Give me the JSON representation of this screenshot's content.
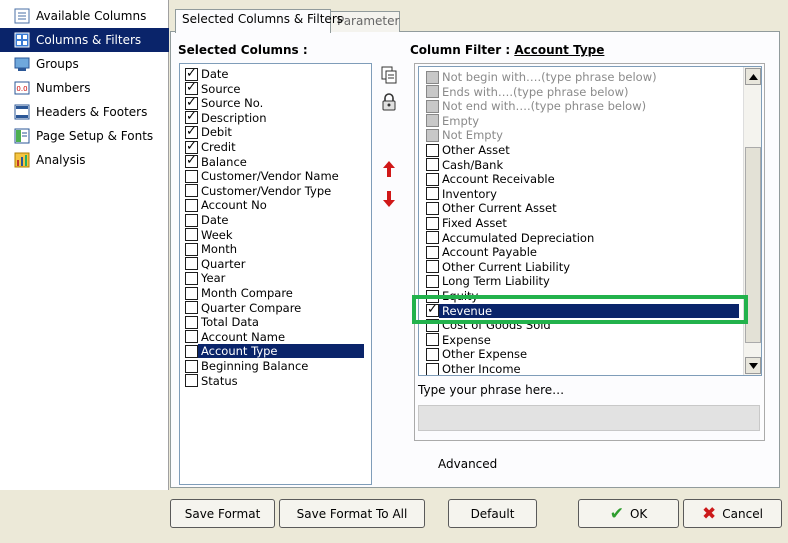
{
  "sidebar": {
    "items": [
      {
        "label": "Available Columns",
        "icon": "columns-list-icon",
        "selected": false
      },
      {
        "label": "Columns & Filters",
        "icon": "filter-grid-icon",
        "selected": true
      },
      {
        "label": "Groups",
        "icon": "groups-icon",
        "selected": false
      },
      {
        "label": "Numbers",
        "icon": "numbers-icon",
        "selected": false
      },
      {
        "label": "Headers & Footers",
        "icon": "header-footer-icon",
        "selected": false
      },
      {
        "label": "Page Setup & Fonts",
        "icon": "page-setup-icon",
        "selected": false
      },
      {
        "label": "Analysis",
        "icon": "chart-icon",
        "selected": false
      }
    ]
  },
  "tabs": [
    {
      "label": "Selected Columns & Filters",
      "active": true
    },
    {
      "label": "Parameter",
      "active": false
    }
  ],
  "selected_columns": {
    "heading": "Selected Columns :",
    "items": [
      {
        "label": "Date",
        "checked": true
      },
      {
        "label": "Source",
        "checked": true
      },
      {
        "label": "Source No.",
        "checked": true
      },
      {
        "label": "Description",
        "checked": true
      },
      {
        "label": "Debit",
        "checked": true
      },
      {
        "label": "Credit",
        "checked": true
      },
      {
        "label": "Balance",
        "checked": true
      },
      {
        "label": "Customer/Vendor Name",
        "checked": false
      },
      {
        "label": "Customer/Vendor Type",
        "checked": false
      },
      {
        "label": "Account No",
        "checked": false
      },
      {
        "label": "Date",
        "checked": false
      },
      {
        "label": "Week",
        "checked": false
      },
      {
        "label": "Month",
        "checked": false
      },
      {
        "label": "Quarter",
        "checked": false
      },
      {
        "label": "Year",
        "checked": false
      },
      {
        "label": "Month Compare",
        "checked": false
      },
      {
        "label": "Quarter Compare",
        "checked": false
      },
      {
        "label": "Total Data",
        "checked": false
      },
      {
        "label": "Account Name",
        "checked": false
      },
      {
        "label": "Account Type",
        "checked": false,
        "selected": true
      },
      {
        "label": "Beginning Balance",
        "checked": false
      },
      {
        "label": "Status",
        "checked": false
      }
    ]
  },
  "middle_tools": [
    {
      "icon": "copy-icon"
    },
    {
      "icon": "lock-icon"
    },
    {
      "icon": "move-up-arrow-icon"
    },
    {
      "icon": "move-down-arrow-icon"
    }
  ],
  "column_filter": {
    "heading": "Column Filter :",
    "field": "Account Type",
    "items": [
      {
        "label": "Not begin with….(type phrase below)",
        "checked": false,
        "disabled": true
      },
      {
        "label": "Ends with….(type phrase below)",
        "checked": false,
        "disabled": true
      },
      {
        "label": "Not end with….(type phrase below)",
        "checked": false,
        "disabled": true
      },
      {
        "label": "Empty",
        "checked": false,
        "disabled": true
      },
      {
        "label": "Not Empty",
        "checked": false,
        "disabled": true
      },
      {
        "label": "Other Asset",
        "checked": false
      },
      {
        "label": "Cash/Bank",
        "checked": false
      },
      {
        "label": "Account Receivable",
        "checked": false
      },
      {
        "label": "Inventory",
        "checked": false
      },
      {
        "label": "Other Current Asset",
        "checked": false
      },
      {
        "label": "Fixed Asset",
        "checked": false
      },
      {
        "label": "Accumulated Depreciation",
        "checked": false
      },
      {
        "label": "Account Payable",
        "checked": false
      },
      {
        "label": "Other Current Liability",
        "checked": false
      },
      {
        "label": "Long Term Liability",
        "checked": false
      },
      {
        "label": "Equity",
        "checked": false
      },
      {
        "label": "Revenue",
        "checked": true,
        "selected": true
      },
      {
        "label": "Cost of Goods Sold",
        "checked": false
      },
      {
        "label": "Expense",
        "checked": false
      },
      {
        "label": "Other Expense",
        "checked": false
      },
      {
        "label": "Other Income",
        "checked": false
      }
    ],
    "phrase_label": "Type your phrase here…",
    "phrase_value": ""
  },
  "advanced_label": "Advanced",
  "buttons": {
    "save_format": "Save Format",
    "save_format_all": "Save Format To All",
    "default": "Default",
    "ok": "OK",
    "cancel": "Cancel"
  },
  "colors": {
    "selection": "#0a246a",
    "highlight_box": "#22b24c",
    "ok_check": "#2e9e2e",
    "cancel_x": "#cc1a1a",
    "arrows": "#d01818"
  }
}
